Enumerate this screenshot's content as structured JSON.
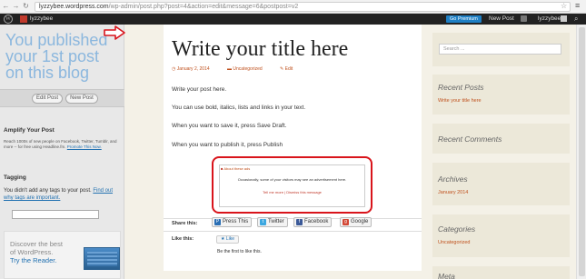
{
  "browser": {
    "url_host": "lyzzybee.wordpress.com",
    "url_path": "/wp-admin/post.php?post=4&action=edit&message=6&postpost=v2"
  },
  "adminbar": {
    "site_name": "lyzzybee",
    "go_premium": "Go Premium",
    "new_post": "New Post",
    "user": "lyzzybee"
  },
  "left_panel": {
    "headline": "You published your 1st post on this blog",
    "edit_post": "Edit Post",
    "new_post": "New Post",
    "amplify_title": "Amplify Your Post",
    "amplify_text": "Reach 1000s of new people on Facebook, Twitter, Tumblr, and more -- for free using Headline.fm.",
    "amplify_link": "Promote This Now.",
    "tagging_title": "Tagging",
    "tagging_text": "You didn't add any tags to your post.",
    "tagging_link": "Find out why tags are important.",
    "reader_line1": "Discover the best",
    "reader_line2": "of WordPress.",
    "reader_line3": "Try the Reader."
  },
  "post": {
    "title": "Write your title here",
    "date": "January 2, 2014",
    "category": "Uncategorized",
    "edit": "Edit",
    "paragraphs": [
      "Write your post here.",
      "You can use bold, italics, lists and links in your text.",
      "When you want to save it, press Save Draft.",
      "When you want to publish it, press Publish"
    ],
    "ad_about": "About these ads",
    "ad_occasionally": "Occasionally, some of your visitors may see an advertisement here.",
    "ad_tell": "Tell me more | Dismiss this message",
    "share_label": "Share this:",
    "share_buttons": [
      "Press This",
      "Twitter",
      "Facebook",
      "Google"
    ],
    "like_label": "Like this:",
    "like_button": "Like",
    "first_like": "Be the first to like this."
  },
  "sidebar": {
    "search_placeholder": "Search ...",
    "recent_posts_title": "Recent Posts",
    "recent_post_item": "Write your title here",
    "recent_comments_title": "Recent Comments",
    "archives_title": "Archives",
    "archive_item": "January 2014",
    "categories_title": "Categories",
    "category_item": "Uncategorized",
    "meta_title": "Meta"
  },
  "colors": {
    "accent_red": "#d9141b",
    "headline_blue": "#8bb7de",
    "link_orange": "#c0521f"
  }
}
